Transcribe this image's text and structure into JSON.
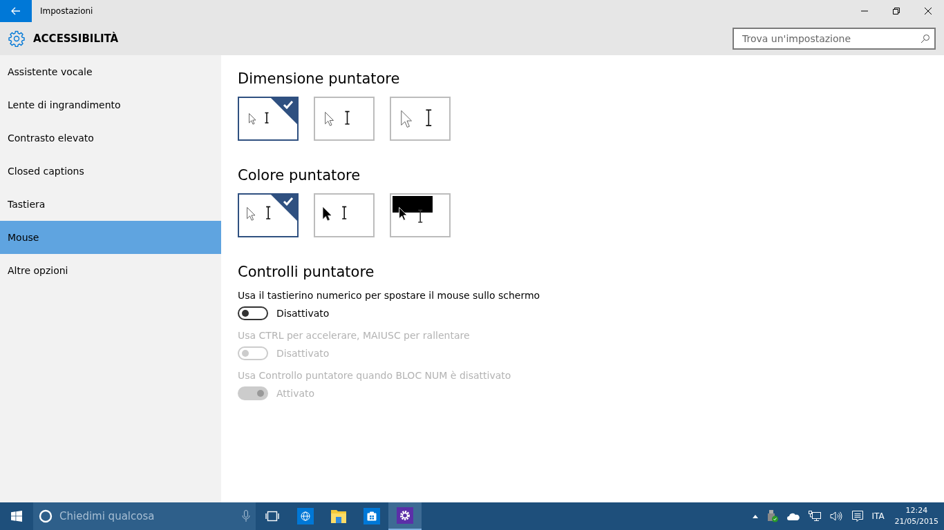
{
  "window": {
    "title": "Impostazioni"
  },
  "header": {
    "title": "ACCESSIBILITÀ",
    "search_placeholder": "Trova un'impostazione"
  },
  "sidebar": {
    "items": [
      {
        "label": "Assistente vocale",
        "selected": false
      },
      {
        "label": "Lente di ingrandimento",
        "selected": false
      },
      {
        "label": "Contrasto elevato",
        "selected": false
      },
      {
        "label": "Closed captions",
        "selected": false
      },
      {
        "label": "Tastiera",
        "selected": false
      },
      {
        "label": "Mouse",
        "selected": true
      },
      {
        "label": "Altre opzioni",
        "selected": false
      }
    ]
  },
  "pointer_size": {
    "title": "Dimensione puntatore",
    "options": [
      {
        "kind": "small",
        "selected": true
      },
      {
        "kind": "medium",
        "selected": false
      },
      {
        "kind": "large",
        "selected": false
      }
    ]
  },
  "pointer_color": {
    "title": "Colore puntatore",
    "options": [
      {
        "kind": "white",
        "selected": true
      },
      {
        "kind": "black",
        "selected": false
      },
      {
        "kind": "inverted",
        "selected": false
      }
    ]
  },
  "pointer_controls": {
    "title": "Controlli puntatore",
    "settings": [
      {
        "label": "Usa il tastierino numerico per spostare il mouse sullo schermo",
        "state": "Disattivato",
        "on": false,
        "disabled": false
      },
      {
        "label": "Usa CTRL per accelerare, MAIUSC per rallentare",
        "state": "Disattivato",
        "on": false,
        "disabled": true
      },
      {
        "label": "Usa Controllo puntatore quando BLOC NUM è disattivato",
        "state": "Attivato",
        "on": true,
        "disabled": true
      }
    ]
  },
  "taskbar": {
    "search_placeholder": "Chiedimi qualcosa",
    "apps": [
      {
        "kind": "taskview",
        "selected": false
      },
      {
        "kind": "browser",
        "selected": false
      },
      {
        "kind": "explorer",
        "selected": false
      },
      {
        "kind": "store",
        "selected": false
      },
      {
        "kind": "settings",
        "selected": true
      }
    ],
    "language": "ITA",
    "time": "12:24",
    "date": "21/05/2015"
  }
}
